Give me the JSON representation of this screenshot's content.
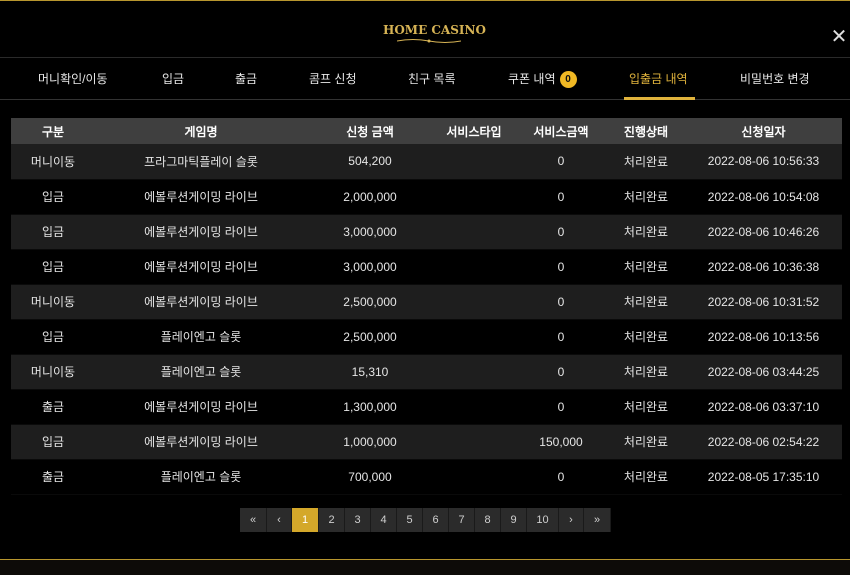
{
  "header": {
    "logo_text": "HOME CASINO",
    "close_icon": "close-icon"
  },
  "tabs": [
    {
      "label": "머니확인/이동"
    },
    {
      "label": "입금"
    },
    {
      "label": "출금"
    },
    {
      "label": "콤프 신청"
    },
    {
      "label": "친구 목록"
    },
    {
      "label": "쿠폰 내역",
      "badge": "0"
    },
    {
      "label": "입출금 내역",
      "active": true
    },
    {
      "label": "비밀번호 변경"
    }
  ],
  "table": {
    "headers": [
      "구분",
      "게임명",
      "신청 금액",
      "서비스타입",
      "서비스금액",
      "진행상태",
      "신청일자"
    ],
    "rows": [
      [
        "머니이동",
        "프라그마틱플레이 슬롯",
        "504,200",
        "",
        "0",
        "처리완료",
        "2022-08-06 10:56:33"
      ],
      [
        "입금",
        "에볼루션게이밍 라이브",
        "2,000,000",
        "",
        "0",
        "처리완료",
        "2022-08-06 10:54:08"
      ],
      [
        "입금",
        "에볼루션게이밍 라이브",
        "3,000,000",
        "",
        "0",
        "처리완료",
        "2022-08-06 10:46:26"
      ],
      [
        "입금",
        "에볼루션게이밍 라이브",
        "3,000,000",
        "",
        "0",
        "처리완료",
        "2022-08-06 10:36:38"
      ],
      [
        "머니이동",
        "에볼루션게이밍 라이브",
        "2,500,000",
        "",
        "0",
        "처리완료",
        "2022-08-06 10:31:52"
      ],
      [
        "입금",
        "플레이엔고 슬롯",
        "2,500,000",
        "",
        "0",
        "처리완료",
        "2022-08-06 10:13:56"
      ],
      [
        "머니이동",
        "플레이엔고 슬롯",
        "15,310",
        "",
        "0",
        "처리완료",
        "2022-08-06 03:44:25"
      ],
      [
        "출금",
        "에볼루션게이밍 라이브",
        "1,300,000",
        "",
        "0",
        "처리완료",
        "2022-08-06 03:37:10"
      ],
      [
        "입금",
        "에볼루션게이밍 라이브",
        "1,000,000",
        "",
        "150,000",
        "처리완료",
        "2022-08-06 02:54:22"
      ],
      [
        "출금",
        "플레이엔고 슬롯",
        "700,000",
        "",
        "0",
        "처리완료",
        "2022-08-05 17:35:10"
      ]
    ]
  },
  "pagination": {
    "first": "«",
    "prev": "‹",
    "pages": [
      "1",
      "2",
      "3",
      "4",
      "5",
      "6",
      "7",
      "8",
      "9",
      "10"
    ],
    "current": "1",
    "next": "›",
    "last": "»"
  },
  "colors": {
    "accent": "#e0b33c",
    "gold_line": "#b8962e",
    "header_bg": "#3f3f3f",
    "row_alt": "#1e1e1e"
  }
}
